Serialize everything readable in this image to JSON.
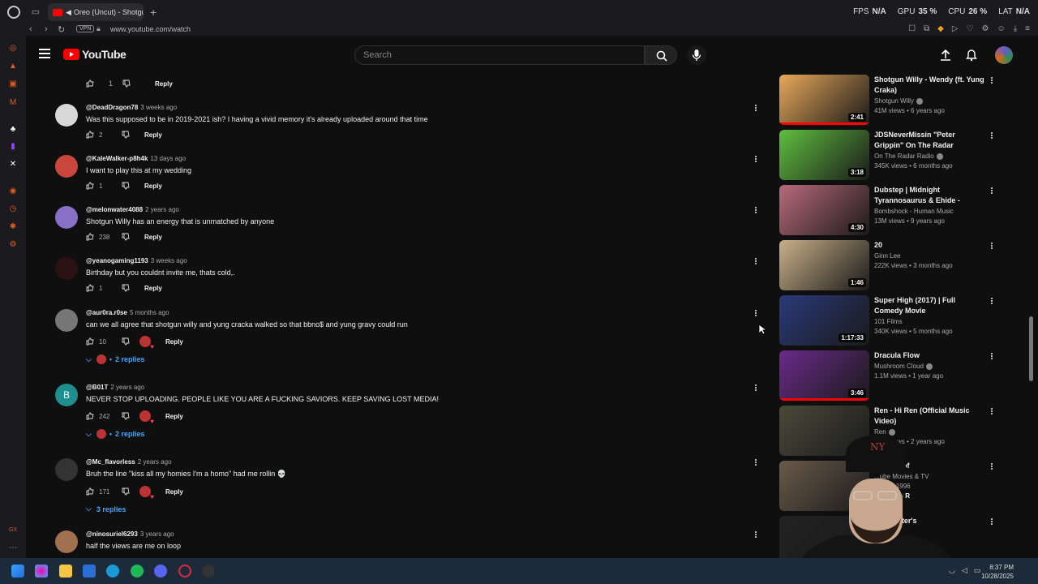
{
  "browser": {
    "tab_title": "Oreo (Uncut) - Shotgu",
    "url": "www.youtube.com/watch",
    "vpn_label": "VPN",
    "hud": {
      "fps_label": "FPS",
      "fps": "N/A",
      "gpu_label": "GPU",
      "gpu": "35 %",
      "cpu_label": "CPU",
      "cpu": "26 %",
      "lat_label": "LAT",
      "lat": "N/A"
    }
  },
  "youtube": {
    "logo_text": "YouTube",
    "search_placeholder": "Search"
  },
  "top_partial": {
    "likes": "1",
    "reply_label": "Reply"
  },
  "comments": [
    {
      "author": "@DeadDragon78",
      "time": "3 weeks ago",
      "text": "Was this supposed to be in 2019-2021 ish? I having a vivid memory it's already uploaded around that time",
      "likes": "2",
      "reply_label": "Reply",
      "avatar_color": "#d8d8d8",
      "creator_heart": false,
      "replies": ""
    },
    {
      "author": "@KaleWalker-p8h4k",
      "time": "13 days ago",
      "text": "I want to play this at my wedding",
      "likes": "1",
      "reply_label": "Reply",
      "avatar_color": "#c9463d",
      "creator_heart": false,
      "replies": ""
    },
    {
      "author": "@melonwater4088",
      "time": "2 years ago",
      "text": "Shotgun Willy has an energy that is unmatched by anyone",
      "likes": "238",
      "reply_label": "Reply",
      "avatar_color": "#8a6fc9",
      "creator_heart": false,
      "replies": ""
    },
    {
      "author": "@yeanogaming1193",
      "time": "3 weeks ago",
      "text": "Birthday but you couldnt invite me, thats cold,.",
      "likes": "1",
      "reply_label": "Reply",
      "avatar_color": "#2a1212",
      "creator_heart": false,
      "replies": ""
    },
    {
      "author": "@aur0ra.r0se",
      "time": "5 months ago",
      "text": "can we all agree that shotgun willy and yung cracka walked so that bbno$ and yung gravy could run",
      "likes": "10",
      "reply_label": "Reply",
      "avatar_color": "#777777",
      "creator_heart": true,
      "replies": "2 replies"
    },
    {
      "author": "@B01T",
      "time": "2 years ago",
      "text": "NEVER STOP UPLOADING. PEOPLE LIKE YOU ARE A FUCKING SAVIORS. KEEP SAVING LOST MEDIA!",
      "likes": "242",
      "reply_label": "Reply",
      "avatar_color": "#1e8e8e",
      "avatar_letter": "B",
      "creator_heart": true,
      "replies": "2 replies"
    },
    {
      "author": "@Mc_flavorless",
      "time": "2 years ago",
      "text": "Bruh the line \"kiss all my homies I'm a homo\" had me rollin 💀",
      "likes": "171",
      "reply_label": "Reply",
      "avatar_color": "#333333",
      "creator_heart": true,
      "replies": "3 replies"
    },
    {
      "author": "@ninosuriel6293",
      "time": "3 years ago",
      "text": "half the views are me on loop",
      "likes": "",
      "reply_label": "",
      "avatar_color": "#a07050",
      "creator_heart": false,
      "replies": ""
    }
  ],
  "recommendations": [
    {
      "title": "Shotgun Willy - Wendy (ft. Yung Craka)",
      "channel": "Shotgun Willy",
      "verified": true,
      "meta": "41M views • 6 years ago",
      "duration": "2:41",
      "thumb_color": "#e8a85a",
      "progress": 1.0
    },
    {
      "title": "JDSNeverMissin \"Peter Grippin\" On The Radar Performance",
      "channel": "On The Radar Radio",
      "verified": true,
      "meta": "345K views • 6 months ago",
      "duration": "3:18",
      "thumb_color": "#5fbf3f",
      "progress": 0.0
    },
    {
      "title": "Dubstep | Midnight Tyrannosaurus & Ehide - Plane...",
      "channel": "Bombshock - Human Music",
      "verified": false,
      "meta": "13M views • 9 years ago",
      "duration": "4:30",
      "thumb_color": "#b86a7a",
      "progress": 0.0
    },
    {
      "title": "20",
      "channel": "Ginn Lee",
      "verified": false,
      "meta": "222K views • 3 months ago",
      "duration": "1:46",
      "thumb_color": "#c9b08a",
      "progress": 0.0
    },
    {
      "title": "Super High (2017) | Full Comedy Movie",
      "channel": "101 Films",
      "verified": false,
      "meta": "340K views • 5 months ago",
      "duration": "1:17:33",
      "thumb_color": "#2a3a7a",
      "progress": 0.0
    },
    {
      "title": "Dracula Flow",
      "channel": "Mushroom Cloud",
      "verified": true,
      "meta": "1.1M views • 1 year ago",
      "duration": "3:46",
      "thumb_color": "#6a2a8a",
      "progress": 1.0
    },
    {
      "title": "Ren - Hi Ren (Official Music Video)",
      "channel": "Ren",
      "verified": true,
      "meta": "51M views • 2 years ago",
      "duration": "",
      "thumb_color": "#4a4a3a",
      "progress": 0.0
    },
    {
      "title": "...lletproof",
      "channel": "...ube Movies & TV",
      "verified": false,
      "meta": "...edy • 1996",
      "duration": "",
      "thumb_color": "#6a5a4a",
      "progress": 0.0
    },
    {
      "title": "... Webster's",
      "channel": "",
      "verified": false,
      "meta": "",
      "duration": "",
      "thumb_color": "#222222",
      "progress": 0.0
    }
  ],
  "rec_badge": "R",
  "rec_badge_prefix": "...with ads",
  "taskbar": {
    "time": "8:37 PM",
    "date": "10/28/2025"
  }
}
